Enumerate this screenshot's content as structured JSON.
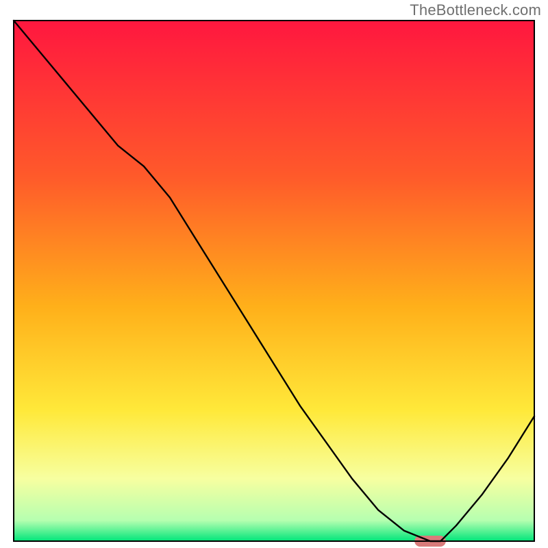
{
  "attribution": "TheBottleneck.com",
  "chart_data": {
    "type": "line",
    "title": "",
    "xlabel": "",
    "ylabel": "",
    "xlim": [
      0,
      100
    ],
    "ylim": [
      0,
      100
    ],
    "series": [
      {
        "name": "bottleneck-curve",
        "x": [
          0,
          5,
          10,
          15,
          20,
          25,
          30,
          35,
          40,
          45,
          50,
          55,
          60,
          65,
          70,
          75,
          80,
          82,
          85,
          90,
          95,
          100
        ],
        "y": [
          100,
          94,
          88,
          82,
          76,
          72,
          66,
          58,
          50,
          42,
          34,
          26,
          19,
          12,
          6,
          2,
          0,
          0,
          3,
          9,
          16,
          24
        ]
      }
    ],
    "markers": [
      {
        "name": "recommended-zone",
        "shape": "rounded-bar",
        "x_start": 77,
        "x_end": 83,
        "y": 0,
        "color": "#d97b7b"
      }
    ],
    "legend": null,
    "grid": false,
    "background_gradient": {
      "type": "vertical",
      "stops": [
        {
          "offset": 0.0,
          "color": "#ff173f"
        },
        {
          "offset": 0.3,
          "color": "#ff5a2a"
        },
        {
          "offset": 0.55,
          "color": "#ffb01a"
        },
        {
          "offset": 0.75,
          "color": "#ffe93a"
        },
        {
          "offset": 0.88,
          "color": "#f7ffa0"
        },
        {
          "offset": 0.96,
          "color": "#b6ffb0"
        },
        {
          "offset": 1.0,
          "color": "#00e57a"
        }
      ]
    }
  },
  "plot": {
    "outer_left": 20,
    "outer_top": 30,
    "outer_right": 780,
    "outer_bottom": 790,
    "frame_color": "#000000",
    "frame_width": 2,
    "curve_color": "#000000",
    "curve_width": 2.4
  }
}
